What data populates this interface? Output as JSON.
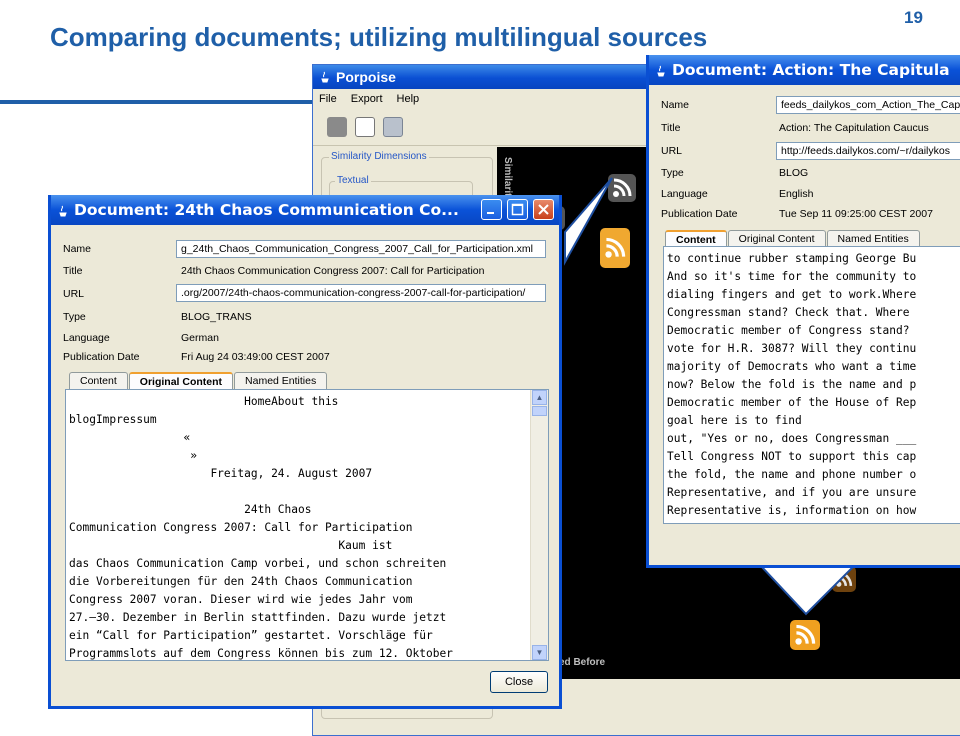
{
  "slide": {
    "title": "Comparing documents; utilizing multilingual sources",
    "number": "19",
    "accent_color": "#1f5fa8"
  },
  "porpoise": {
    "title": "Porpoise",
    "menu": [
      "File",
      "Export",
      "Help"
    ],
    "panel": {
      "group_label": "Similarity Dimensions",
      "sub_label": "Textual"
    },
    "viz_vertical_label": "Similarity",
    "viz_bottom_label": "ed Before"
  },
  "doc_left": {
    "title": "Document: 24th Chaos Communication Co...",
    "labels": {
      "name": "Name",
      "title": "Title",
      "url": "URL",
      "type": "Type",
      "language": "Language",
      "pubdate": "Publication Date"
    },
    "name": "g_24th_Chaos_Communication_Congress_2007_Call_for_Participation.xml",
    "doc_title": "24th Chaos Communication Congress 2007: Call for Participation",
    "url": ".org/2007/24th-chaos-communication-congress-2007-call-for-participation/",
    "type": "BLOG_TRANS",
    "language": "German",
    "pubdate": "Fri Aug 24 03:49:00 CEST 2007",
    "tabs": [
      "Content",
      "Original Content",
      "Named Entities"
    ],
    "active_tab": "Original Content",
    "content_lines": [
      "                          HomeAbout this",
      "blogImpressum",
      "                 «",
      "                  »",
      "                     Freitag, 24. August 2007",
      "",
      "                          24th Chaos",
      "Communication Congress 2007: Call for Participation",
      "                                        Kaum ist",
      "das Chaos Communication Camp vorbei, und schon schreiten",
      "die Vorbereitungen für den 24th Chaos Communication",
      "Congress 2007 voran. Dieser wird wie jedes Jahr vom",
      "27.–30. Dezember in Berlin stattfinden. Dazu wurde jetzt",
      "ein “Call for Participation” gestartet. Vorschläge für",
      "Programmslots auf dem Congress können bis zum 12. Oktober"
    ],
    "close_label": "Close"
  },
  "doc_right": {
    "title": "Document: Action: The Capitula",
    "labels": {
      "name": "Name",
      "title": "Title",
      "url": "URL",
      "type": "Type",
      "language": "Language",
      "pubdate": "Publication Date"
    },
    "name": "feeds_dailykos_com_Action_The_Cap",
    "doc_title": "Action: The Capitulation Caucus",
    "url": "http://feeds.dailykos.com/~r/dailykos",
    "type": "BLOG",
    "language": "English",
    "pubdate": "Tue Sep 11 09:25:00 CEST 2007",
    "tabs": [
      "Content",
      "Original Content",
      "Named Entities"
    ],
    "active_tab": "Content",
    "content_lines": [
      "to continue rubber stamping George Bu",
      "And so it's time for the community to",
      "dialing fingers and get to work.Where",
      "Congressman stand? Check that. Where",
      "Democratic member of Congress stand?",
      "vote for H.R. 3087? Will they continu",
      "majority of Democrats who want a time",
      "now? Below the fold is the name and p",
      "Democratic member of the House of Rep",
      "goal here is to find",
      "out, \"Yes or no, does Congressman ___",
      "Tell Congress NOT to support this cap",
      "the fold, the name and phone number o",
      "Representative, and if you are unsure",
      "Representative is, information on how"
    ]
  }
}
